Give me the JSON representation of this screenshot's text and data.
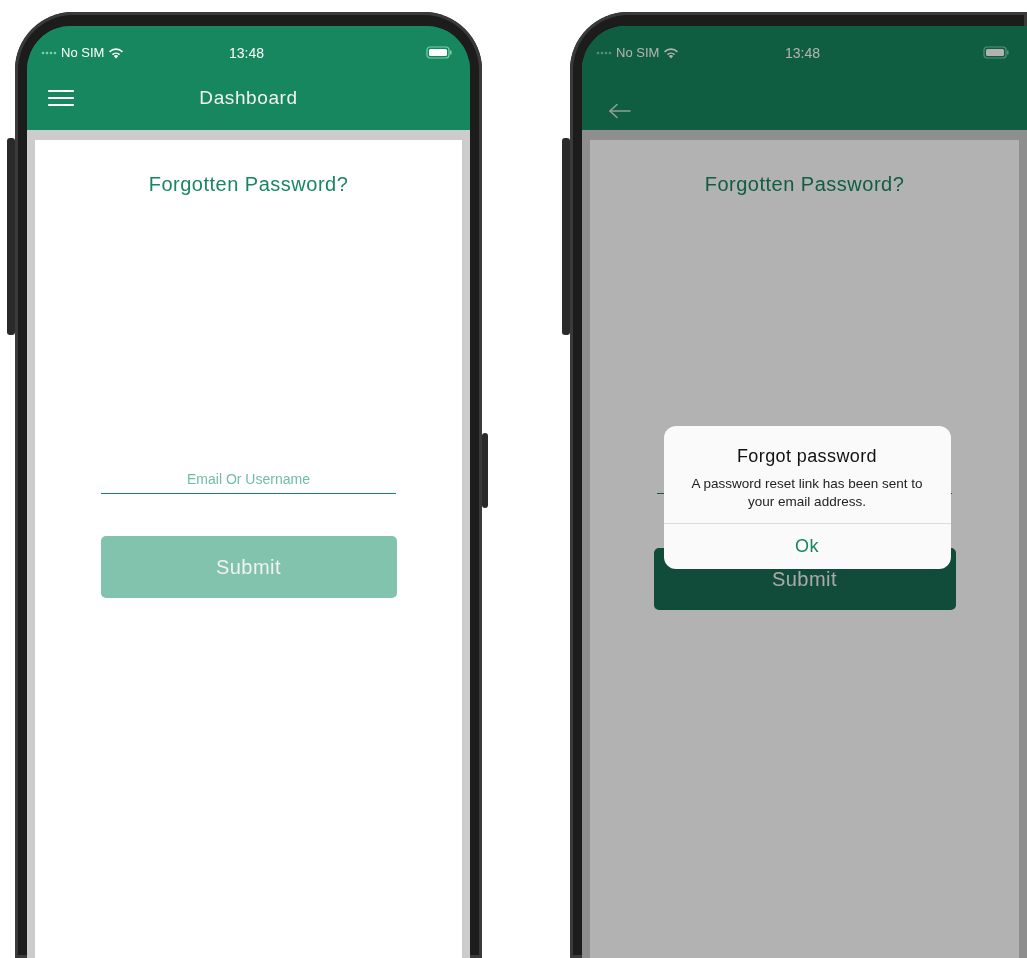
{
  "phones": [
    {
      "status_bar": {
        "carrier": "No SIM",
        "time": "13:48"
      },
      "app_bar": {
        "kind": "menu",
        "title": "Dashboard"
      },
      "form": {
        "heading": "Forgotten Password?",
        "field": {
          "placeholder": "Email Or Username"
        },
        "submit": {
          "label": "Submit",
          "disabled": true
        }
      },
      "dimmed": false
    },
    {
      "status_bar": {
        "carrier": "No SIM",
        "time": "13:48"
      },
      "app_bar": {
        "kind": "back"
      },
      "form": {
        "heading": "Forgotten Password?",
        "submit": {
          "label": "Submit",
          "disabled": false
        }
      },
      "dimmed": true,
      "dialog": {
        "title": "Forgot password",
        "message": "A password reset link has been sent to your email address.",
        "button": "Ok"
      }
    }
  ]
}
